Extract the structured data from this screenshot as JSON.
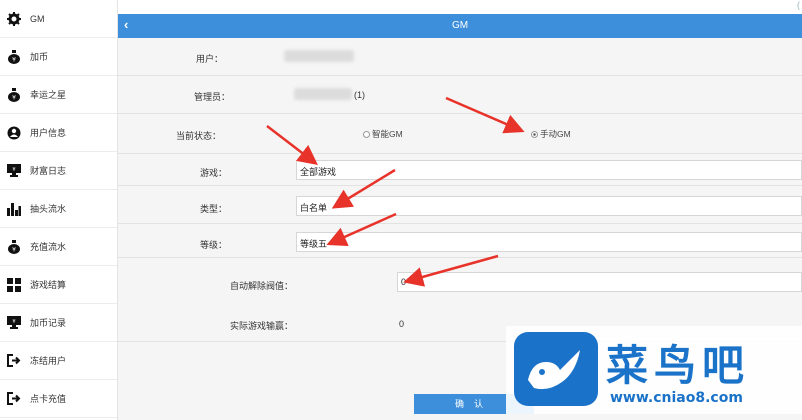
{
  "sidebar": {
    "items": [
      {
        "label": "GM",
        "icon": "gear-icon"
      },
      {
        "label": "加币",
        "icon": "money-bag-icon"
      },
      {
        "label": "幸运之星",
        "icon": "money-bag-icon"
      },
      {
        "label": "用户信息",
        "icon": "user-icon"
      },
      {
        "label": "财富日志",
        "icon": "monitor-icon"
      },
      {
        "label": "抽头流水",
        "icon": "bar-chart-icon"
      },
      {
        "label": "充值流水",
        "icon": "money-bag-icon"
      },
      {
        "label": "游戏结算",
        "icon": "grid-icon"
      },
      {
        "label": "加币记录",
        "icon": "monitor-icon"
      },
      {
        "label": "冻结用户",
        "icon": "logout-icon"
      },
      {
        "label": "点卡充值",
        "icon": "logout-icon"
      }
    ]
  },
  "header": {
    "back": "‹",
    "title": "GM",
    "corner": "("
  },
  "form": {
    "user_label": "用户：",
    "admin_label": "管理员：",
    "admin_suffix": "(1)",
    "status_label": "当前状态：",
    "status_options": [
      {
        "label": "智能GM",
        "selected": false
      },
      {
        "label": "手动GM",
        "selected": true
      }
    ],
    "game_label": "游戏：",
    "game_value": "全部游戏",
    "type_label": "类型：",
    "type_value": "白名单",
    "level_label": "等级：",
    "level_value": "等级五",
    "threshold_label": "自动解除阀值：",
    "threshold_value": "0",
    "actual_label": "实际游戏输赢：",
    "actual_value": "0",
    "confirm": "确认"
  },
  "watermark": {
    "cn": "菜鸟吧",
    "url": "www.cniao8.com"
  },
  "colors": {
    "accent": "#3d8fdc",
    "arrow": "#e8332a",
    "watermark": "#1a73c9"
  }
}
